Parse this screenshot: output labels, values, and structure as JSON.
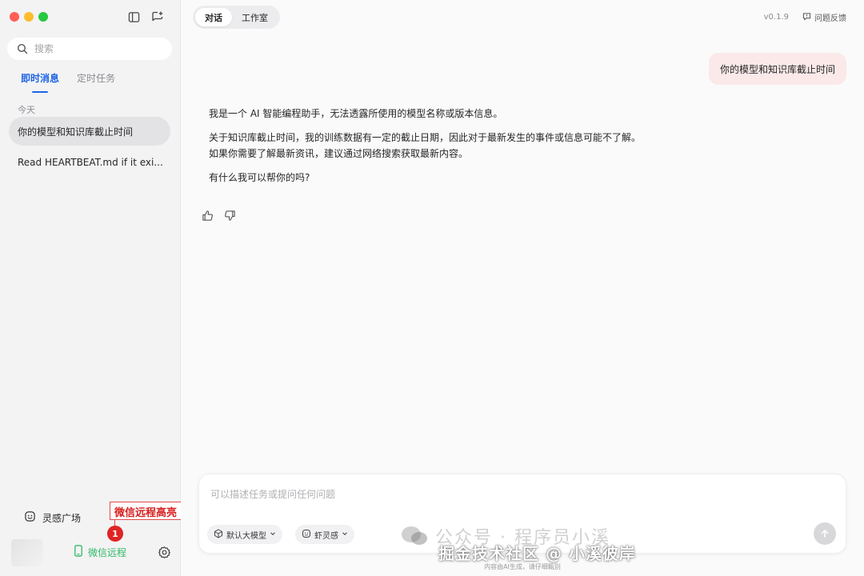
{
  "sidebar": {
    "search": {
      "placeholder": "搜索"
    },
    "tabs": [
      {
        "label": "即时消息",
        "active": true
      },
      {
        "label": "定时任务",
        "active": false
      }
    ],
    "section_label": "今天",
    "conversations": [
      {
        "title": "你的模型和知识库截止时间",
        "active": true
      },
      {
        "title": "Read HEARTBEAT.md if it exi...",
        "active": false
      }
    ],
    "inspiration": {
      "label": "灵感广场",
      "icon": "smile-icon"
    },
    "wechat_remote": {
      "label": "微信远程",
      "icon": "phone-icon"
    },
    "annotation": {
      "text": "微信远程高亮",
      "badge": "1"
    }
  },
  "header": {
    "segments": [
      {
        "label": "对话",
        "active": true
      },
      {
        "label": "工作室",
        "active": false
      }
    ],
    "version": "v0.1.9",
    "feedback_label": "问题反馈"
  },
  "chat": {
    "user_message": "你的模型和知识库截止时间",
    "assistant_paragraphs": [
      "我是一个 AI 智能编程助手，无法透露所使用的模型名称或版本信息。",
      "关于知识库截止时间，我的训练数据有一定的截止日期，因此对于最新发生的事件或信息可能不了解。如果你需要了解最新资讯，建议通过网络搜索获取最新内容。",
      "有什么我可以帮你的吗?"
    ]
  },
  "composer": {
    "placeholder": "可以描述任务或提问任何问题",
    "model_chip": "默认大模型",
    "inspire_chip": "虾灵感"
  },
  "disclaimer": "内容由AI生成，请仔细甄别",
  "watermark": {
    "line1": "公众号 · 程序员小溪",
    "line2": "掘金技术社区 @ 小溪彼岸"
  },
  "colors": {
    "accent": "#1e64e6",
    "wechat_green": "#33b866",
    "annotation_red": "#d92020",
    "user_bubble": "#fbe9ea"
  }
}
